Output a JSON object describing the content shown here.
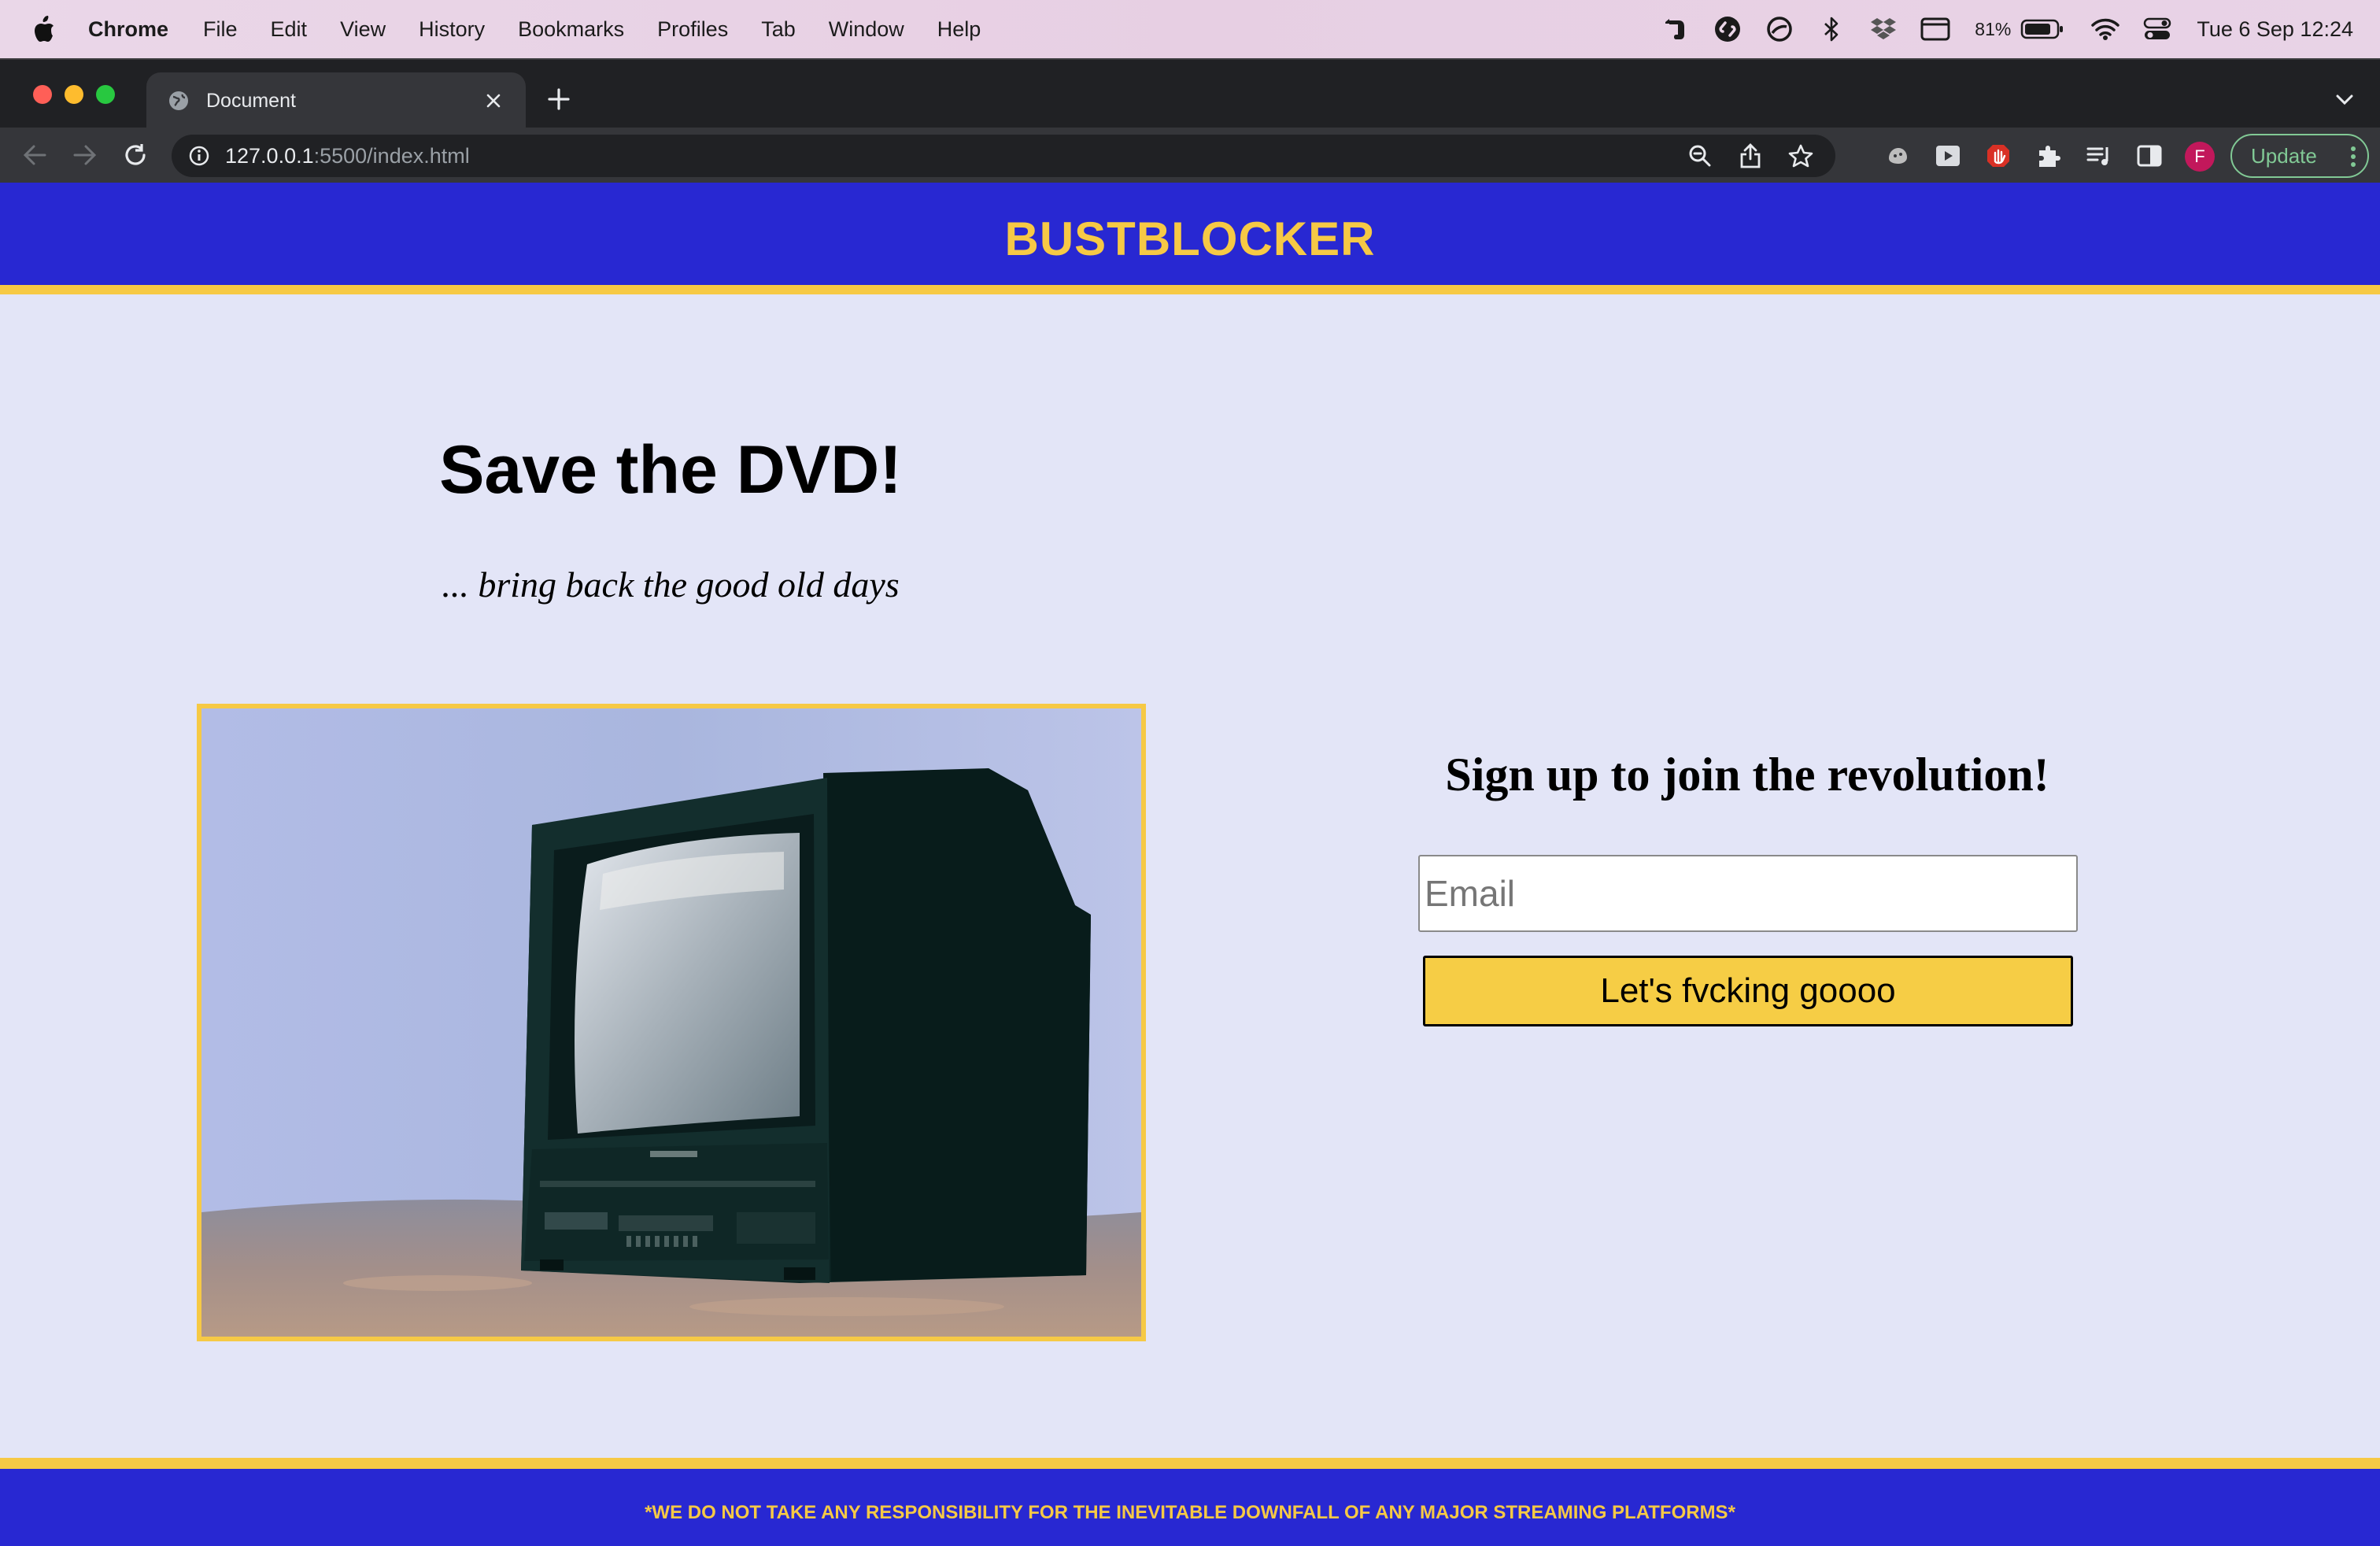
{
  "os_menubar": {
    "app_name": "Chrome",
    "menus": [
      "File",
      "Edit",
      "View",
      "History",
      "Bookmarks",
      "Profiles",
      "Tab",
      "Window",
      "Help"
    ],
    "battery_percent": "81%",
    "clock": "Tue 6 Sep  12:24",
    "tray_icons": [
      "evernote-icon",
      "shazam-icon",
      "sync-icon",
      "bluetooth-icon",
      "dropbox-icon",
      "screen-icon",
      "battery-icon",
      "wifi-icon",
      "control-center-icon"
    ]
  },
  "browser": {
    "tab": {
      "title": "Document"
    },
    "url": {
      "host": "127.0.0.1",
      "path": ":5500/index.html"
    },
    "profile_initial": "F",
    "update_label": "Update",
    "colors": {
      "tab_strip": "#202124",
      "toolbar": "#35363a",
      "update_accent": "#81c995"
    }
  },
  "page": {
    "header": {
      "title": "BUSTBLOCKER"
    },
    "hero": {
      "title": "Save the DVD!",
      "subtitle": "... bring back the good old days"
    },
    "image": {
      "subject": "tv-photo"
    },
    "signup": {
      "heading": "Sign up to join the revolution!",
      "email_placeholder": "Email",
      "email_value": "",
      "button_label": "Let's fvcking goooo"
    },
    "footer": {
      "note": "*WE DO NOT TAKE ANY RESPONSIBILITY FOR THE INEVITABLE DOWNFALL OF ANY MAJOR STREAMING PLATFORMS*"
    },
    "colors": {
      "brand_blue": "#2828d2",
      "brand_yellow": "#f6c945",
      "background": "#e3e5f7"
    }
  }
}
